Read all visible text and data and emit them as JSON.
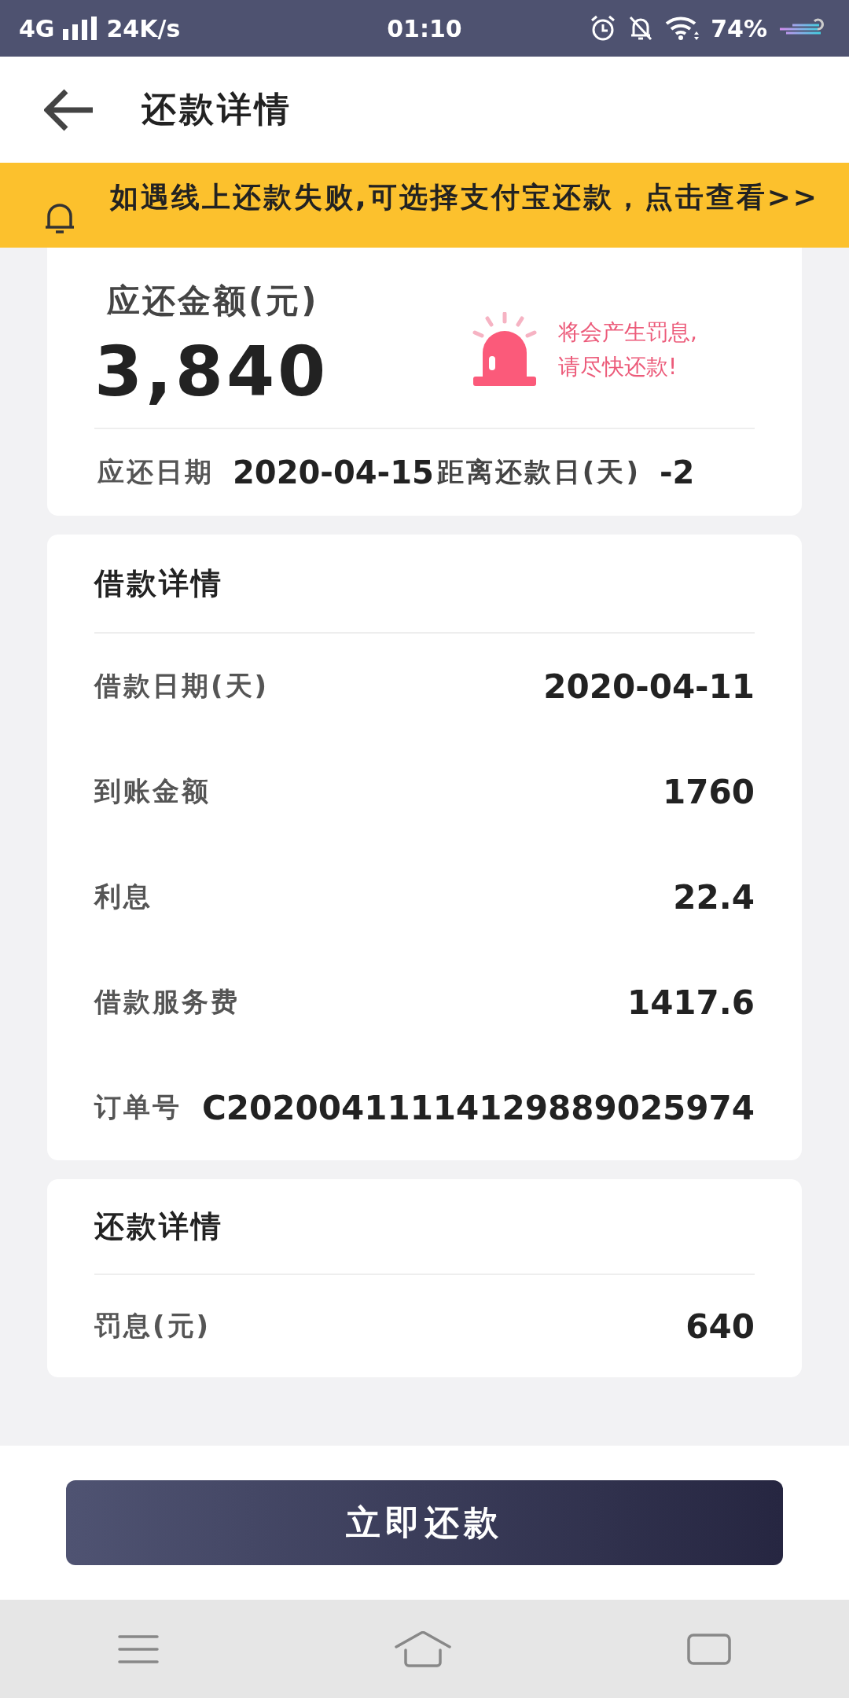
{
  "status_bar": {
    "network": "4G",
    "speed": "24K/s",
    "time": "01:10",
    "battery": "74%"
  },
  "header": {
    "title": "还款详情"
  },
  "notice": {
    "text": "如遇线上还款失败,可选择支付宝还款，点击查看>>"
  },
  "summary": {
    "amount_label": "应还金额(元)",
    "amount": "3,840",
    "warning": "将会产生罚息,请尽快还款!",
    "due_label": "应还日期",
    "due_date": "2020-04-15",
    "days_label": "距离还款日(天)",
    "days": "-2"
  },
  "loan": {
    "title": "借款详情",
    "rows": [
      {
        "label": "借款日期(天)",
        "value": "2020-04-11"
      },
      {
        "label": "到账金额",
        "value": "1760"
      },
      {
        "label": "利息",
        "value": "22.4"
      },
      {
        "label": "借款服务费",
        "value": "1417.6"
      },
      {
        "label": "订单号",
        "value": "C20200411114129889025974"
      }
    ]
  },
  "repayment": {
    "title": "还款详情",
    "rows": [
      {
        "label": "罚息(元)",
        "value": "640"
      }
    ]
  },
  "action": {
    "label": "立即还款"
  }
}
